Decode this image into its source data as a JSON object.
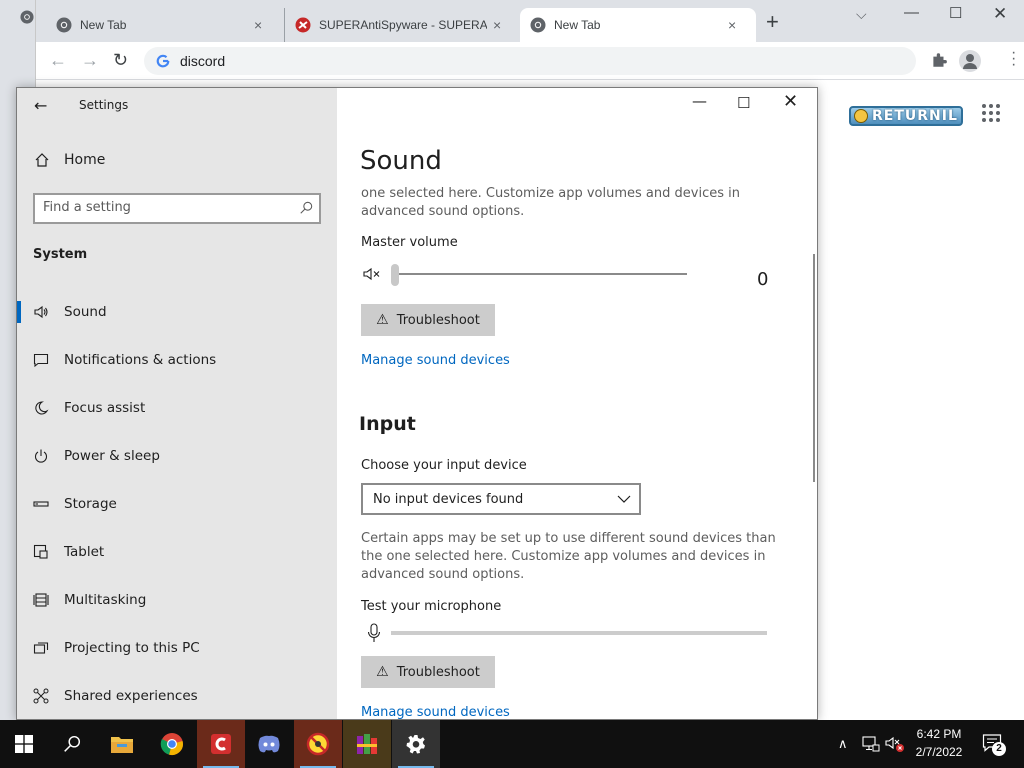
{
  "browser": {
    "tabs": [
      {
        "title": "New Tab",
        "icon": "chrome-icon"
      },
      {
        "title": "SUPERAntiSpyware - SUPERAnti",
        "icon": "superantispyware-icon"
      },
      {
        "title": "New Tab",
        "icon": "chrome-icon",
        "active": true
      }
    ],
    "tab_close": "×",
    "new_tab": "+",
    "address": "discord",
    "controls": {
      "minimize": "—",
      "maximize": "☐",
      "close": "✕"
    },
    "logo_text": "RETURNIL"
  },
  "settings": {
    "window_title": "Settings",
    "controls": {
      "back": "←",
      "minimize": "—",
      "maximize": "☐",
      "close": "✕"
    },
    "home_label": "Home",
    "search_placeholder": "Find a setting",
    "category": "System",
    "nav_items": [
      {
        "label": "Sound",
        "icon": "speaker-icon",
        "selected": true
      },
      {
        "label": "Notifications & actions",
        "icon": "notification-icon"
      },
      {
        "label": "Focus assist",
        "icon": "moon-icon"
      },
      {
        "label": "Power & sleep",
        "icon": "power-icon"
      },
      {
        "label": "Storage",
        "icon": "storage-icon"
      },
      {
        "label": "Tablet",
        "icon": "tablet-icon"
      },
      {
        "label": "Multitasking",
        "icon": "multitasking-icon"
      },
      {
        "label": "Projecting to this PC",
        "icon": "projecting-icon"
      },
      {
        "label": "Shared experiences",
        "icon": "shared-experiences-icon"
      }
    ],
    "page_title": "Sound",
    "output": {
      "description": "one selected here. Customize app volumes and devices in advanced sound options.",
      "master_volume_label": "Master volume",
      "master_volume_value": "0",
      "troubleshoot_label": "Troubleshoot",
      "manage_devices_label": "Manage sound devices"
    },
    "input": {
      "heading": "Input",
      "choose_device_label": "Choose your input device",
      "selected_device": "No input devices found",
      "description": "Certain apps may be set up to use different sound devices than the one selected here. Customize app volumes and devices in advanced sound options.",
      "test_mic_label": "Test your microphone",
      "troubleshoot_label": "Troubleshoot",
      "manage_devices_label": "Manage sound devices"
    }
  },
  "taskbar": {
    "items": [
      "start-icon",
      "search-icon",
      "file-explorer-icon",
      "chrome-icon",
      "comodo-icon",
      "discord-icon",
      "superantispyware-icon",
      "winrar-icon",
      "settings-gear-icon"
    ],
    "clock_time": "6:42 PM",
    "clock_date": "2/7/2022",
    "notification_count": "2",
    "tray_overflow": "∧"
  },
  "colors": {
    "accent": "#0067c0",
    "taskbar": "#101010",
    "nav_bg": "#e6e6e6"
  }
}
